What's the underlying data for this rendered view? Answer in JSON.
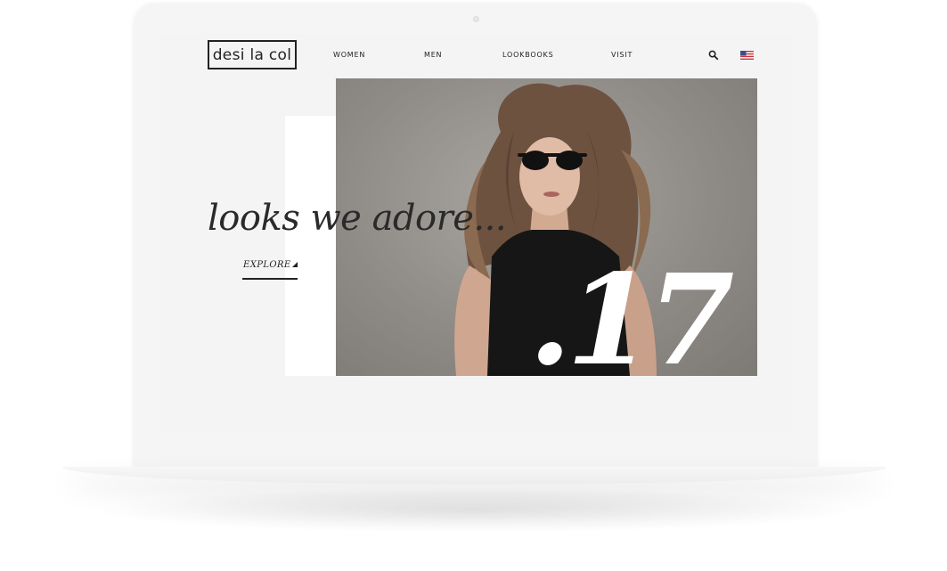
{
  "brand": {
    "logo_text": "desi la col"
  },
  "nav": {
    "items": [
      {
        "label": "WOMEN"
      },
      {
        "label": "MEN"
      },
      {
        "label": "LOOKBOOKS"
      },
      {
        "label": "VISIT"
      }
    ],
    "search_icon": "search-icon",
    "flag_icon": "us-flag-icon"
  },
  "hero": {
    "headline": "looks we adore...",
    "cta_label": "EXPLORE",
    "issue_number": ".17",
    "image": "woman-with-sunglasses-photo"
  },
  "colors": {
    "background": "#f4f4f4",
    "text": "#222222",
    "hero_bg": "#8f8b87",
    "panel": "#ffffff"
  }
}
